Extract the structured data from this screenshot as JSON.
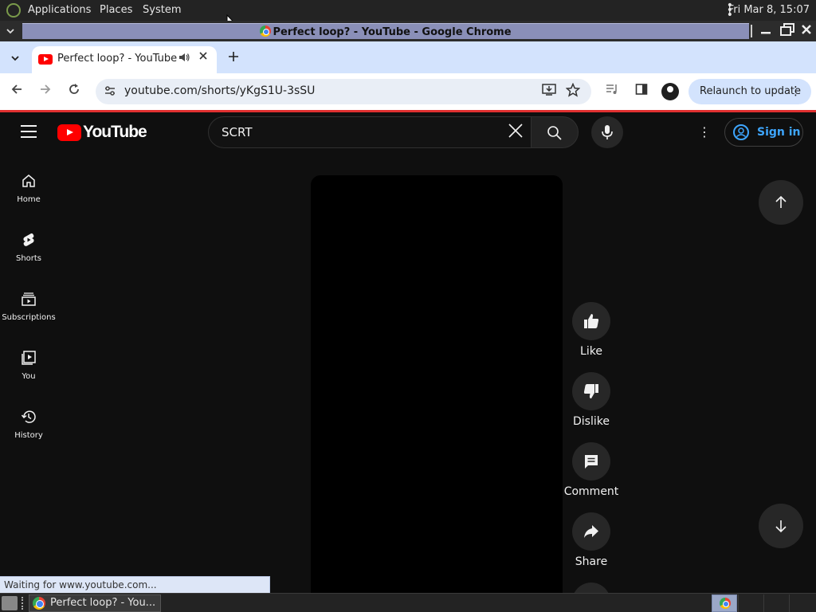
{
  "os_panel": {
    "menus": [
      "Applications",
      "Places",
      "System"
    ],
    "clock": "Fri Mar  8, 15:07"
  },
  "window": {
    "title": "Perfect loop? - YouTube - Google Chrome"
  },
  "browser": {
    "tab_title": "Perfect loop? - YouTube",
    "url": "youtube.com/shorts/yKgS1U-3sSU",
    "relaunch_label": "Relaunch to update",
    "status_text": "Waiting for www.youtube.com..."
  },
  "youtube": {
    "wordmark": "YouTube",
    "search_value": "SCRT",
    "sign_in_label": "Sign in",
    "sidebar": [
      {
        "label": "Home",
        "icon": "home-icon"
      },
      {
        "label": "Shorts",
        "icon": "shorts-icon"
      },
      {
        "label": "Subscriptions",
        "icon": "subscriptions-icon"
      },
      {
        "label": "You",
        "icon": "you-icon"
      },
      {
        "label": "History",
        "icon": "history-icon"
      }
    ],
    "actions": [
      {
        "label": "Like",
        "icon": "thumbs-up-icon"
      },
      {
        "label": "Dislike",
        "icon": "thumbs-down-icon"
      },
      {
        "label": "Comment",
        "icon": "comment-icon"
      },
      {
        "label": "Share",
        "icon": "share-icon"
      }
    ]
  },
  "taskbar": {
    "task_label": "Perfect loop? - You..."
  },
  "colors": {
    "youtube_red": "#ff0000",
    "youtube_bg": "#0f0f0f",
    "signin_blue": "#3ea6ff",
    "chrome_tab_strip": "#d3e3fd"
  }
}
